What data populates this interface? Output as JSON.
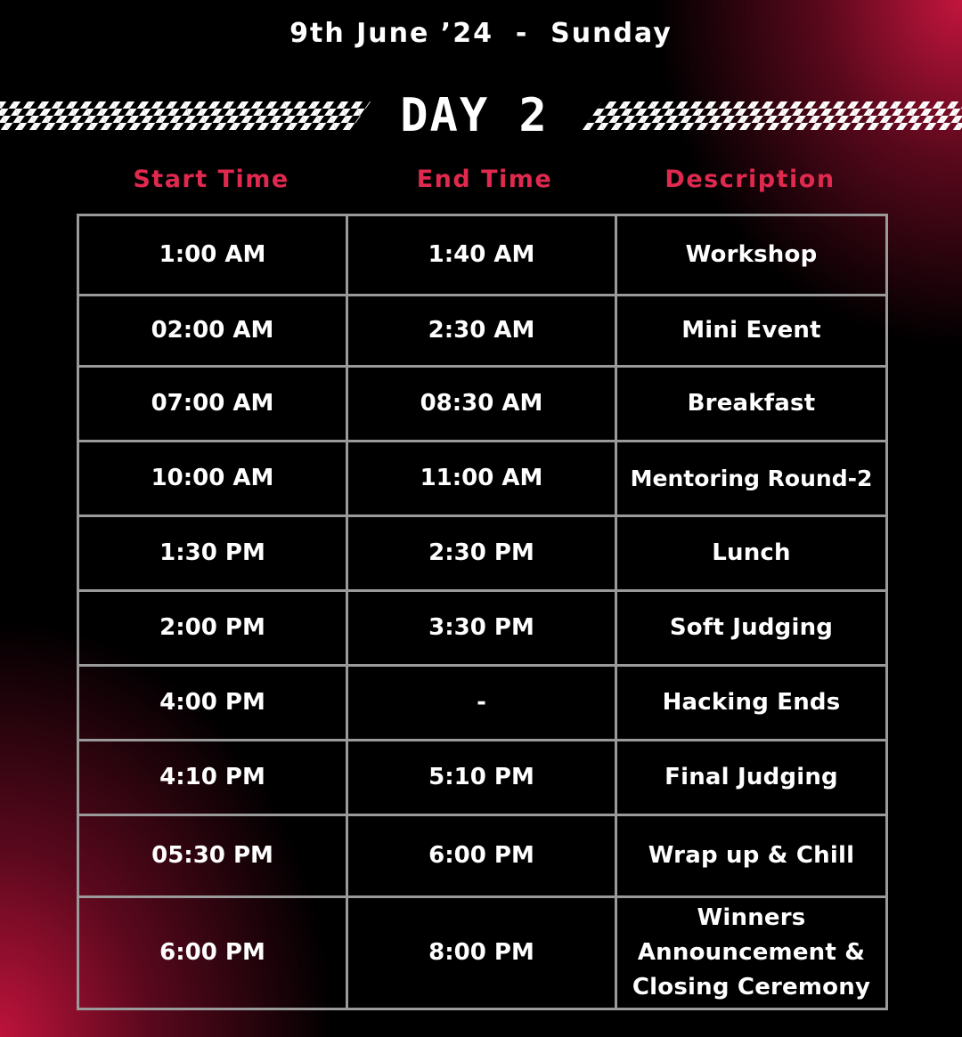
{
  "header": {
    "date": "9th June ’24  -  Sunday",
    "day_title": "DAY 2"
  },
  "columns": [
    "Start Time",
    "End Time",
    "Description"
  ],
  "rows": [
    {
      "start": "1:00 AM",
      "end": "1:40 AM",
      "desc": "Workshop"
    },
    {
      "start": "02:00 AM",
      "end": "2:30 AM",
      "desc": "Mini Event"
    },
    {
      "start": "07:00 AM",
      "end": "08:30 AM",
      "desc": "Breakfast"
    },
    {
      "start": "10:00 AM",
      "end": "11:00 AM",
      "desc": "Mentoring Round-2"
    },
    {
      "start": "1:30 PM",
      "end": "2:30 PM",
      "desc": "Lunch"
    },
    {
      "start": "2:00 PM",
      "end": "3:30 PM",
      "desc": "Soft Judging"
    },
    {
      "start": "4:00 PM",
      "end": "-",
      "desc": "Hacking Ends"
    },
    {
      "start": "4:10 PM",
      "end": "5:10 PM",
      "desc": "Final Judging"
    },
    {
      "start": "05:30 PM",
      "end": "6:00 PM",
      "desc": "Wrap up & Chill"
    },
    {
      "start": "6:00 PM",
      "end": "8:00 PM",
      "desc": "Winners Announcement & Closing Ceremony"
    }
  ],
  "colors": {
    "accent": "#e0294f",
    "background": "#000000",
    "gradient": "#c8163e",
    "border": "#9a9a9a",
    "text": "#ffffff"
  }
}
